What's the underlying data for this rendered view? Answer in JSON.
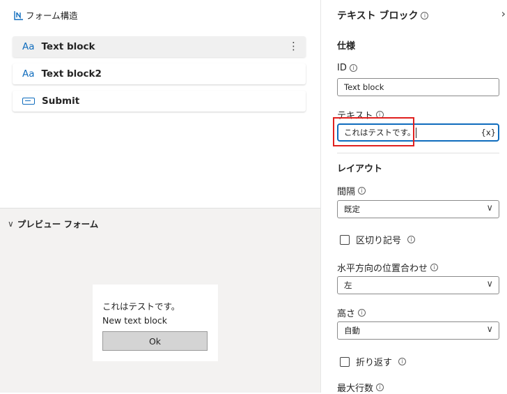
{
  "tree": {
    "title": "フォーム構造",
    "items": [
      {
        "icon": "Aa",
        "label": "Text block",
        "more": "⋮"
      },
      {
        "icon": "Aa",
        "label": "Text block2"
      },
      {
        "label": "Submit"
      }
    ]
  },
  "preview": {
    "title": "プレビュー フォーム",
    "text1": "これはテストです。",
    "text2": "New text block",
    "ok": "Ok"
  },
  "panel": {
    "title": "テキスト ブロック",
    "section_spec": "仕様",
    "id_label": "ID",
    "id_value": "Text block",
    "text_label": "テキスト",
    "text_value": "これはテストです。",
    "fx": "{x}",
    "section_layout": "レイアウト",
    "spacing_label": "間隔",
    "spacing_value": "既定",
    "separator_label": "区切り記号",
    "halign_label": "水平方向の位置合わせ",
    "halign_value": "左",
    "height_label": "高さ",
    "height_value": "自動",
    "wrap_label": "折り返す",
    "maxlines_label": "最大行数"
  },
  "colors": {
    "accent": "#0f6cbd",
    "highlight": "#e0201e"
  }
}
